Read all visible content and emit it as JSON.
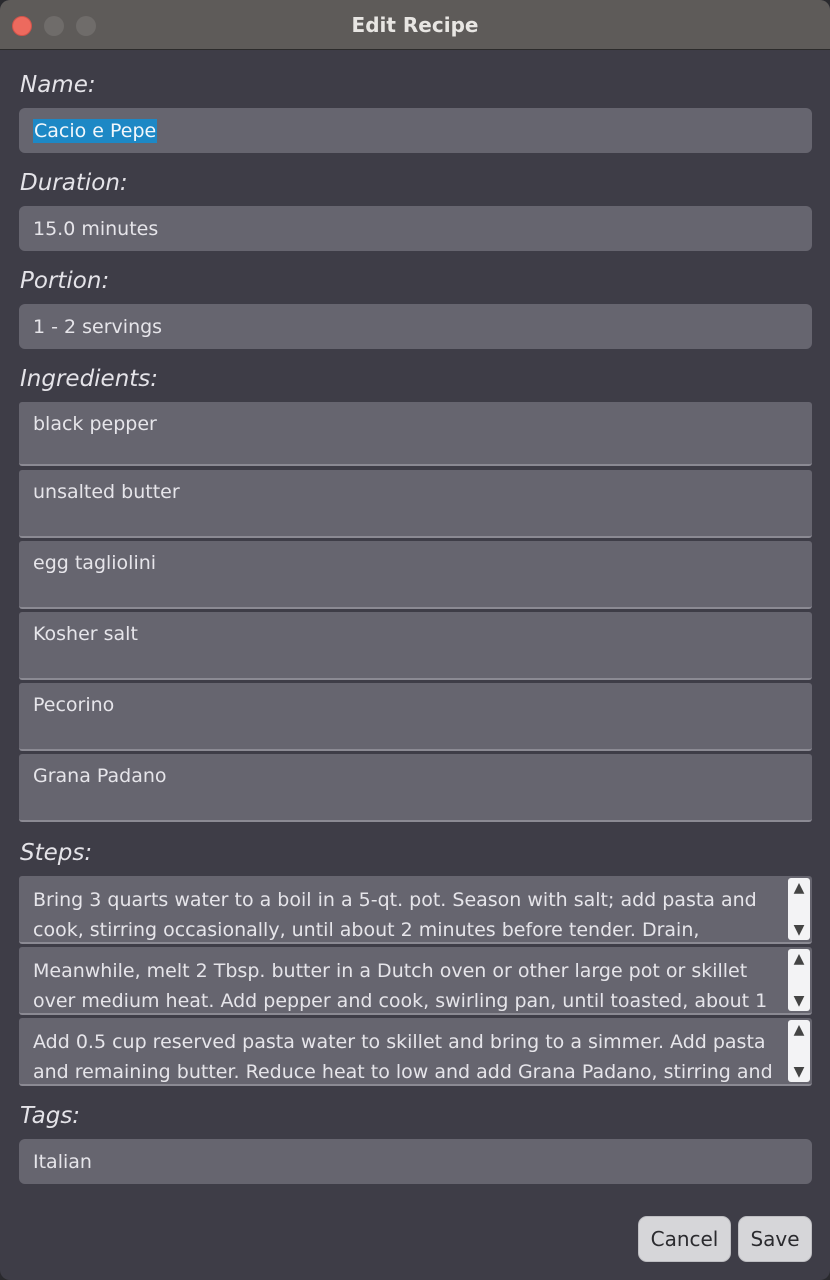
{
  "window": {
    "title": "Edit Recipe"
  },
  "form": {
    "name_label": "Name:",
    "name_value": "Cacio e Pepe",
    "duration_label": "Duration:",
    "duration_value": "15.0 minutes",
    "portion_label": "Portion:",
    "portion_value": "1 - 2 servings",
    "ingredients_label": "Ingredients:",
    "ingredients": [
      "black pepper",
      "unsalted butter",
      "egg tagliolini",
      "Kosher salt",
      "Pecorino",
      "Grana Padano"
    ],
    "steps_label": "Steps:",
    "steps": [
      "Bring 3 quarts water to a boil in a 5-qt. pot. Season with salt; add pasta and cook, stirring occasionally, until about 2 minutes before tender. Drain, reserving",
      "Meanwhile, melt 2 Tbsp. butter in a Dutch oven or other large pot or skillet over medium heat. Add pepper and cook, swirling pan, until toasted, about 1",
      "Add 0.5 cup reserved pasta water to skillet and bring to a simmer. Add pasta and remaining butter. Reduce heat to low and add Grana Padano, stirring and"
    ],
    "tags_label": "Tags:",
    "tags_value": "Italian"
  },
  "buttons": {
    "cancel": "Cancel",
    "save": "Save"
  },
  "icons": {
    "scroll_up": "▲",
    "scroll_down": "▼"
  },
  "colors": {
    "selection": "#1d88c5",
    "close_button": "#ed6a5e"
  }
}
